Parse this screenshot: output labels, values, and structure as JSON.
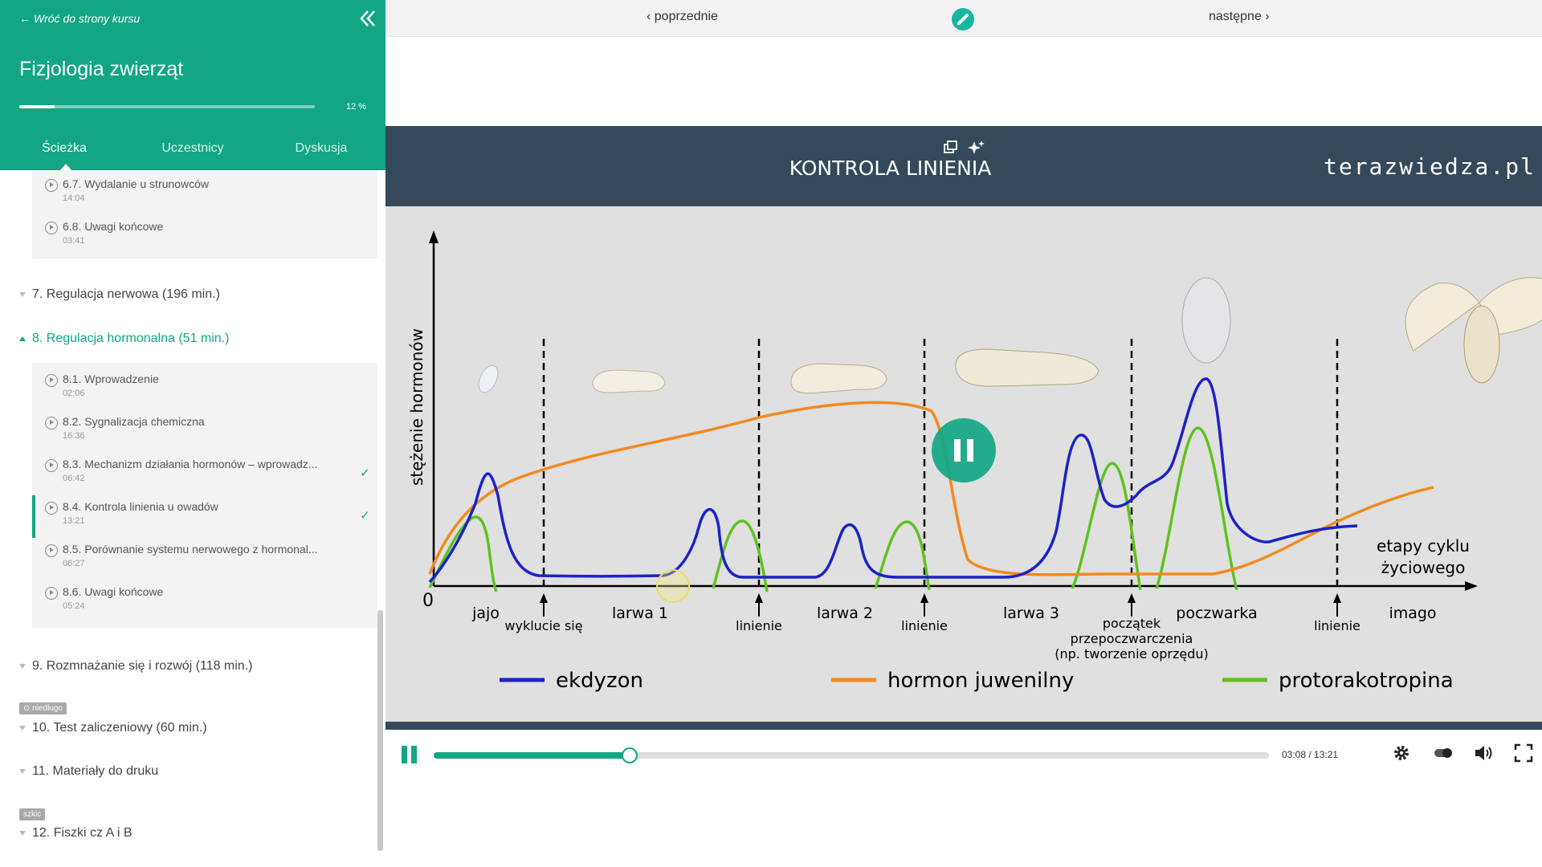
{
  "sidebar": {
    "back_link": "← Wróć do strony kursu",
    "course_title": "Fizjologia zwierząt",
    "progress_text": "12 %",
    "progress_fraction": 0.12,
    "tabs": [
      {
        "label": "Ścieżka",
        "active": true
      },
      {
        "label": "Uczestnicy",
        "active": false
      },
      {
        "label": "Dyskusja",
        "active": false
      }
    ],
    "section6_lessons": [
      {
        "title": "6.7. Wydalanie u strunowców",
        "time": "14:04"
      },
      {
        "title": "6.8. Uwagi końcowe",
        "time": "03:41"
      }
    ],
    "sections": {
      "s7": "7. Regulacja nerwowa (196 min.)",
      "s8": "8. Regulacja hormonalna (51 min.)",
      "s9": "9. Rozmnażanie się i rozwój (118 min.)",
      "s10": "10. Test zaliczeniowy (60 min.)",
      "s11": "11. Materiały do druku",
      "s12": "12. Fiszki cz A i B"
    },
    "section8_lessons": [
      {
        "title": "8.1. Wprowadzenie",
        "time": "02:06",
        "done": false
      },
      {
        "title": "8.2. Sygnalizacja chemiczna",
        "time": "16:36",
        "done": false
      },
      {
        "title": "8.3. Mechanizm działania hormonów – wprowadz...",
        "time": "06:42",
        "done": true
      },
      {
        "title": "8.4. Kontrola linienia u owadów",
        "time": "13:21",
        "done": true,
        "current": true
      },
      {
        "title": "8.5. Porównanie systemu nerwowego z hormonal...",
        "time": "06:27",
        "done": false
      },
      {
        "title": "8.6. Uwagi końcowe",
        "time": "05:24",
        "done": false
      }
    ],
    "badge_soon": "niedługo",
    "badge_draft": "szkic",
    "check_mark": "✓"
  },
  "topnav": {
    "prev": "‹ poprzednie",
    "next": "następne ›"
  },
  "video": {
    "title": "KONTROLA LINIENIA",
    "brand": "terazwiedza.pl",
    "y_axis_label": "stężenie hormonów",
    "origin_label": "0",
    "x_axis_label_line1": "etapy cyklu",
    "x_axis_label_line2": "życiowego",
    "stages": [
      "jajo",
      "larwa 1",
      "larwa 2",
      "larwa 3",
      "poczwarka",
      "imago"
    ],
    "events": [
      "wyklucie się",
      "linienie",
      "linienie",
      "linienie"
    ],
    "event_pupation": [
      "początek",
      "przepoczwarczenia",
      "(np. tworzenie oprzędu)"
    ],
    "legend": [
      {
        "name": "ekdyzon",
        "color": "#1a22c8"
      },
      {
        "name": "hormon juwenilny",
        "color": "#f28a1e"
      },
      {
        "name": "protorakotropina",
        "color": "#5fc21e"
      }
    ]
  },
  "player": {
    "time": "03:08 / 13:21",
    "progress_fraction": 0.235,
    "accent": "#12a683"
  }
}
